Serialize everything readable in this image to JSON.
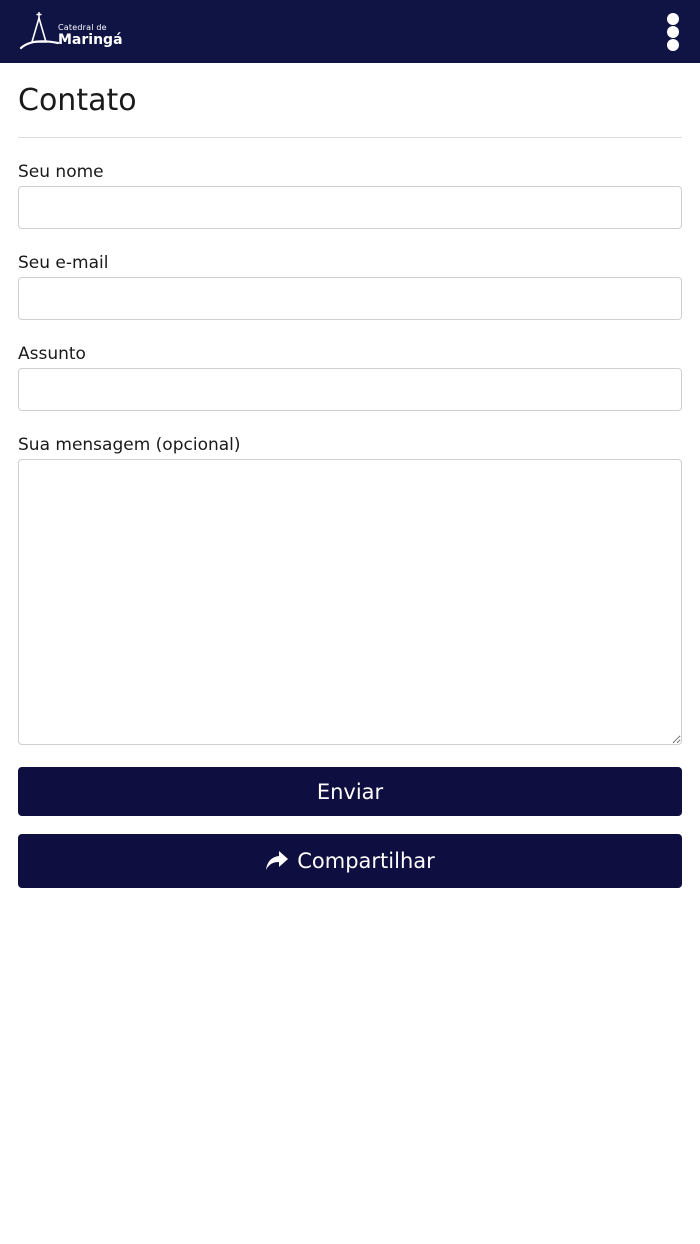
{
  "header": {
    "logo": {
      "small_text": "Catedral de",
      "big_text": "Maringá"
    },
    "menu_icon": "kebab-menu-icon",
    "background_color": "#0f1445"
  },
  "page": {
    "title": "Contato"
  },
  "form": {
    "name": {
      "label": "Seu nome",
      "value": "",
      "placeholder": ""
    },
    "email": {
      "label": "Seu e-mail",
      "value": "",
      "placeholder": ""
    },
    "subject": {
      "label": "Assunto",
      "value": "",
      "placeholder": ""
    },
    "message": {
      "label": "Sua mensagem (opcional)",
      "value": "",
      "placeholder": ""
    },
    "submit_label": "Enviar"
  },
  "share": {
    "label": "Compartilhar",
    "icon": "share-arrow-icon"
  },
  "colors": {
    "button": "#0f0e40",
    "border": "#cfcfcf"
  }
}
